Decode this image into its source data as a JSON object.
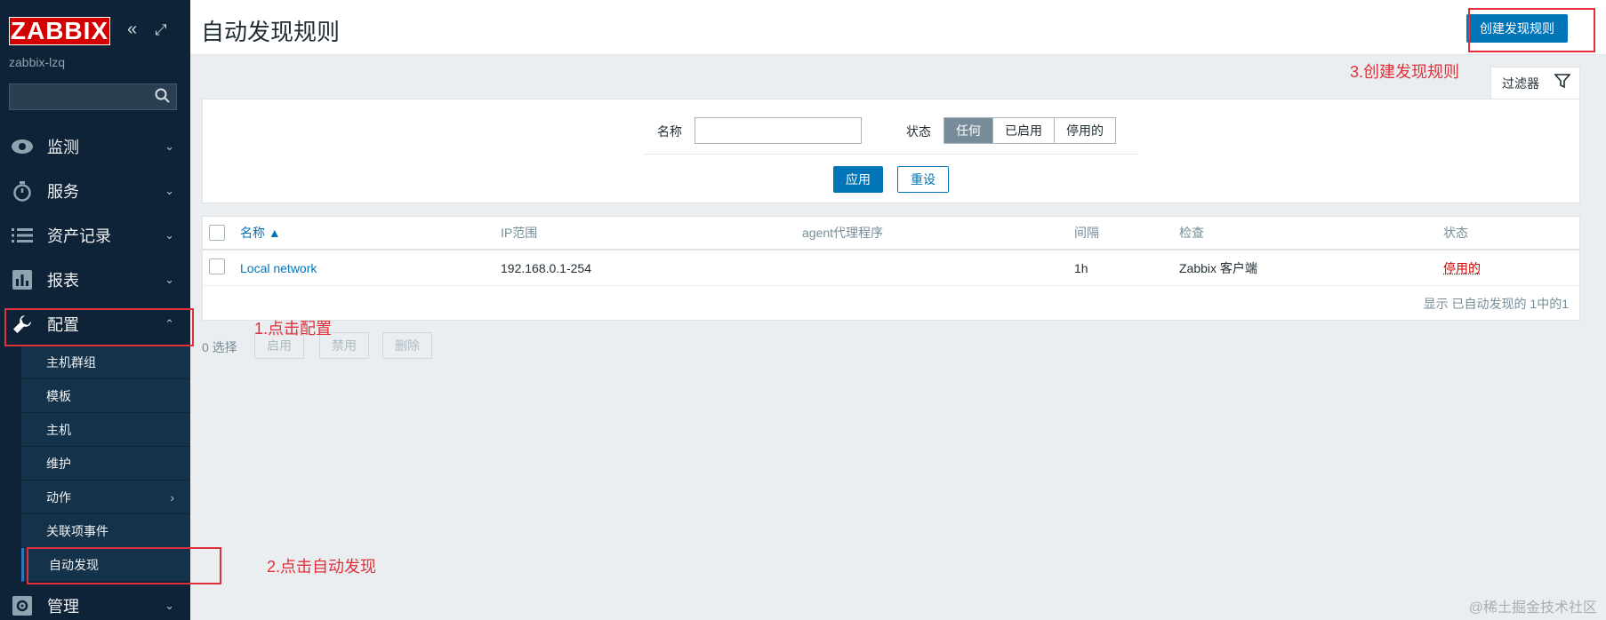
{
  "sidebar": {
    "logo": "ZABBIX",
    "server_name": "zabbix-lzq",
    "search_placeholder": "",
    "nav": [
      {
        "label": "监测"
      },
      {
        "label": "服务"
      },
      {
        "label": "资产记录"
      },
      {
        "label": "报表"
      },
      {
        "label": "配置"
      },
      {
        "label": "管理"
      }
    ],
    "config_sub": [
      {
        "label": "主机群组"
      },
      {
        "label": "模板"
      },
      {
        "label": "主机"
      },
      {
        "label": "维护"
      },
      {
        "label": "动作"
      },
      {
        "label": "关联项事件"
      },
      {
        "label": "自动发现"
      }
    ]
  },
  "header": {
    "title": "自动发现规则",
    "create_button": "创建发现规则"
  },
  "filter": {
    "tab_label": "过滤器",
    "name_label": "名称",
    "name_value": "",
    "status_label": "状态",
    "status_options": [
      "任何",
      "已启用",
      "停用的"
    ],
    "status_selected": "任何",
    "apply": "应用",
    "reset": "重设"
  },
  "table": {
    "columns": [
      "名称 ▲",
      "IP范围",
      "agent代理程序",
      "间隔",
      "检查",
      "状态"
    ],
    "rows": [
      {
        "name": "Local network",
        "ip_range": "192.168.0.1-254",
        "proxy": "",
        "interval": "1h",
        "checks": "Zabbix 客户端",
        "status": "停用的"
      }
    ],
    "footer": "显示 已自动发现的 1中的1"
  },
  "actions": {
    "selected": "0 选择",
    "enable": "启用",
    "disable": "禁用",
    "delete": "删除"
  },
  "annotations": {
    "step1": "1.点击配置",
    "step2": "2.点击自动发现",
    "step3": "3.创建发现规则"
  },
  "watermark": "@稀土掘金技术社区",
  "colors": {
    "sidebar_bg": "#0e2337",
    "accent": "#0275b8",
    "annotation": "#e0303a",
    "status_disabled": "#d40000"
  }
}
